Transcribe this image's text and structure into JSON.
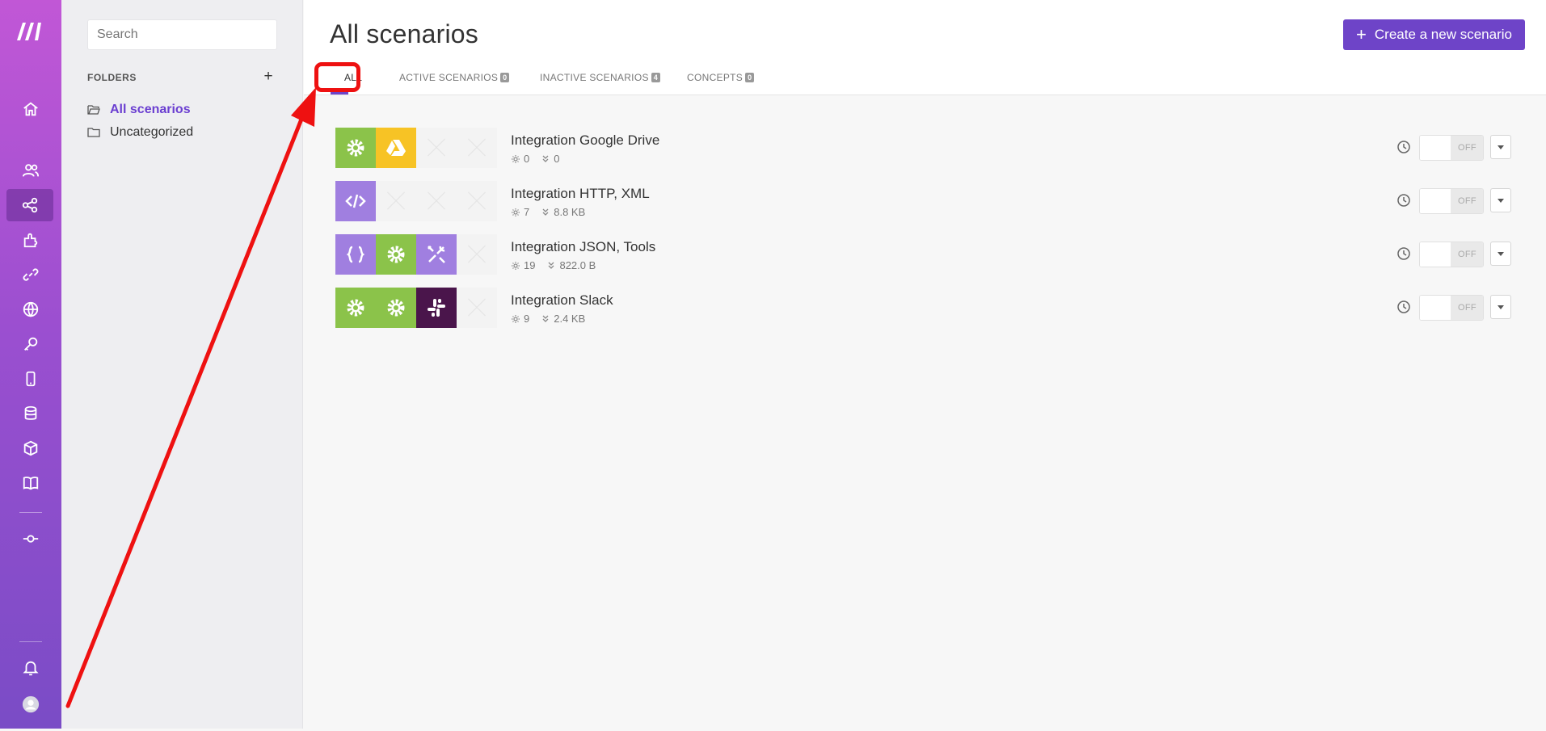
{
  "sidebar": {
    "icons": [
      "make-logo-icon",
      "home-icon",
      "team-icon",
      "scenarios-icon",
      "templates-icon",
      "connections-icon",
      "webhooks-icon",
      "keys-icon",
      "devices-icon",
      "data-stores-icon",
      "data-structures-icon",
      "docs-icon",
      "flow-control-icon",
      "notifications-icon",
      "avatar-icon"
    ],
    "accent": "#9b4fd0"
  },
  "folders": {
    "search_placeholder": "Search",
    "heading": "FOLDERS",
    "add_label": "+",
    "items": [
      {
        "label": "All scenarios",
        "active": true
      },
      {
        "label": "Uncategorized",
        "active": false
      }
    ]
  },
  "header": {
    "title": "All scenarios",
    "create_button": "Create a new scenario",
    "create_plus": "+"
  },
  "tabs": [
    {
      "label": "ALL",
      "count": null,
      "active": true
    },
    {
      "label": "ACTIVE SCENARIOS",
      "count": "0"
    },
    {
      "label": "INACTIVE SCENARIOS",
      "count": "4"
    },
    {
      "label": "CONCEPTS",
      "count": "0"
    }
  ],
  "scenarios": [
    {
      "name": "Integration Google Drive",
      "ops": "0",
      "transfer": "0",
      "modules": [
        "tools",
        "google-drive"
      ],
      "status": "OFF"
    },
    {
      "name": "Integration HTTP, XML",
      "ops": "7",
      "transfer": "8.8 KB",
      "modules": [
        "xml"
      ],
      "status": "OFF"
    },
    {
      "name": "Integration JSON, Tools",
      "ops": "19",
      "transfer": "822.0 B",
      "modules": [
        "json",
        "tools",
        "tools-wrench"
      ],
      "status": "OFF"
    },
    {
      "name": "Integration Slack",
      "ops": "9",
      "transfer": "2.4 KB",
      "modules": [
        "tools",
        "tools",
        "slack"
      ],
      "status": "OFF"
    }
  ],
  "colors": {
    "primary": "#6e44c8",
    "tools_green": "#8bc34a",
    "drive_yellow": "#f7c325",
    "purple_module": "#a07fe0",
    "slack_dark": "#4a154b",
    "annotation_red": "#ee1111"
  }
}
